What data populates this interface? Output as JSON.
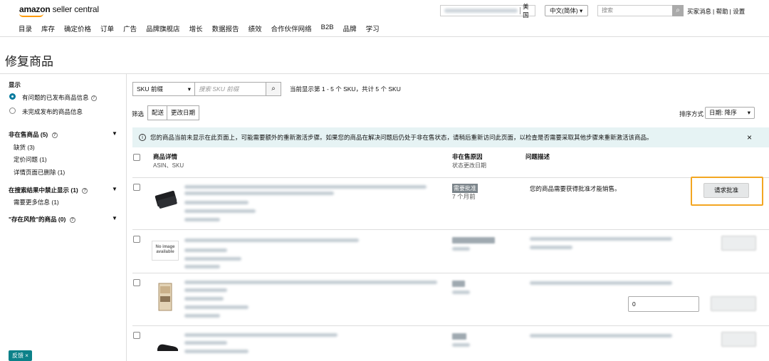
{
  "header": {
    "logo_brand": "amazon",
    "logo_product": " seller central",
    "marketplace": "美国",
    "language": "中文(简体)",
    "search_placeholder": "搜索",
    "links": [
      "买家消息",
      "帮助",
      "设置"
    ],
    "nav": [
      "目录",
      "库存",
      "确定价格",
      "订单",
      "广告",
      "品牌旗舰店",
      "增长",
      "数据报告",
      "绩效",
      "合作伙伴网络",
      "B2B",
      "品牌",
      "学习"
    ]
  },
  "page": {
    "title": "修复商品"
  },
  "sidebar": {
    "show_label": "显示",
    "option1": "有问题的已发布商品信息",
    "option2": "未完成发布的商品信息",
    "group1": "非在售商品 (5)",
    "g1_items": [
      "缺货 (3)",
      "定价问题 (1)",
      "详情页面已删除 (1)"
    ],
    "group2": "在搜索结果中禁止显示 (1)",
    "g2_items": [
      "需要更多信息 (1)"
    ],
    "group3": "\"存在风险\"的商品 (0)",
    "feedback": "反馈"
  },
  "toolbar": {
    "sku_select": "SKU 前缀",
    "sku_placeholder": "搜索 SKU 前缀",
    "count_text": "当前显示第 1 - 5 个 SKU，共计 5 个 SKU",
    "filter_label": "筛选",
    "filter_btn1": "配送",
    "filter_btn2": "更改日期",
    "sort_label": "排序方式",
    "sort_value": "日期: 降序"
  },
  "info": {
    "text": "您的商品当前未显示在此页面上，可能需要额外的重新激活步骤。如果您的商品在解决问题后仍处于非在售状态，请稍后重新访问此页面，以检查是否需要采取其他步骤来重新激活该商品。"
  },
  "table": {
    "col1": "商品详情",
    "col1_sub": "ASIN、SKU",
    "col2": "非在售原因",
    "col2_sub": "状态更改日期",
    "col3": "问题描述"
  },
  "rows": [
    {
      "reason": "需要批准",
      "age": "7 个月前",
      "problem": "您的商品需要获得批准才能销售。",
      "action": "请求批准"
    },
    {
      "no_image_text": "No image available"
    },
    {
      "qty": "0"
    }
  ],
  "colors": {
    "accent": "#027a9e",
    "highlight": "#f3a621",
    "info_bg": "#e6f3f4"
  }
}
